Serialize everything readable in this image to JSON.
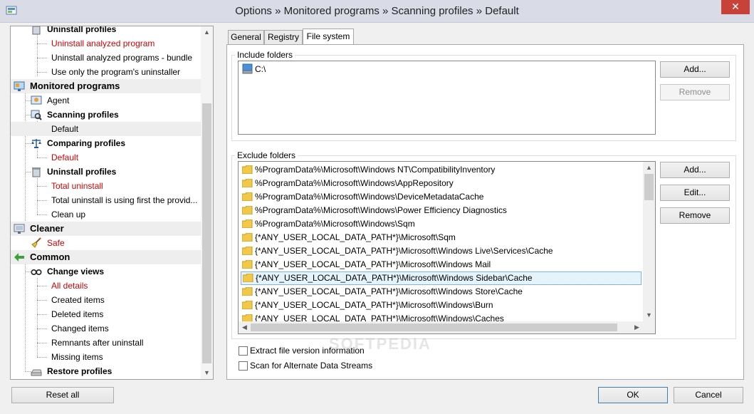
{
  "window": {
    "title": "Options » Monitored programs » Scanning profiles » Default",
    "close_glyph": "✕"
  },
  "tree": {
    "items": [
      {
        "label": "Uninstall profiles"
      },
      {
        "label": "Uninstall analyzed program"
      },
      {
        "label": "Uninstall analyzed programs - bundle"
      },
      {
        "label": "Use only the program's uninstaller"
      },
      {
        "label": "Monitored programs"
      },
      {
        "label": "Agent"
      },
      {
        "label": "Scanning profiles"
      },
      {
        "label": "Default"
      },
      {
        "label": "Comparing profiles"
      },
      {
        "label": "Default"
      },
      {
        "label": "Uninstall profiles"
      },
      {
        "label": "Total uninstall"
      },
      {
        "label": "Total uninstall is using first the provid..."
      },
      {
        "label": "Clean up"
      },
      {
        "label": "Cleaner"
      },
      {
        "label": "Safe"
      },
      {
        "label": "Common"
      },
      {
        "label": "Change views"
      },
      {
        "label": "All details"
      },
      {
        "label": "Created items"
      },
      {
        "label": "Deleted items"
      },
      {
        "label": "Changed items"
      },
      {
        "label": "Remnants after uninstall"
      },
      {
        "label": "Missing items"
      },
      {
        "label": "Restore profiles"
      }
    ]
  },
  "tabs": [
    {
      "label": "General"
    },
    {
      "label": "Registry"
    },
    {
      "label": "File system"
    }
  ],
  "include": {
    "label": "Include folders",
    "items": [
      "C:\\"
    ],
    "add_button": "Add...",
    "remove_button": "Remove"
  },
  "exclude": {
    "label": "Exclude folders",
    "items": [
      "%ProgramData%\\Microsoft\\Windows NT\\CompatibilityInventory",
      "%ProgramData%\\Microsoft\\Windows\\AppRepository",
      "%ProgramData%\\Microsoft\\Windows\\DeviceMetadataCache",
      "%ProgramData%\\Microsoft\\Windows\\Power Efficiency Diagnostics",
      "%ProgramData%\\Microsoft\\Windows\\Sqm",
      "{*ANY_USER_LOCAL_DATA_PATH*}\\Microsoft\\Sqm",
      "{*ANY_USER_LOCAL_DATA_PATH*}\\Microsoft\\Windows Live\\Services\\Cache",
      "{*ANY_USER_LOCAL_DATA_PATH*}\\Microsoft\\Windows Mail",
      "{*ANY_USER_LOCAL_DATA_PATH*}\\Microsoft\\Windows Sidebar\\Cache",
      "{*ANY_USER_LOCAL_DATA_PATH*}\\Microsoft\\Windows Store\\Cache",
      "{*ANY_USER_LOCAL_DATA_PATH*}\\Microsoft\\Windows\\Burn",
      "{*ANY_USER_LOCAL_DATA_PATH*}\\Microsoft\\Windows\\Caches"
    ],
    "add_button": "Add...",
    "edit_button": "Edit...",
    "remove_button": "Remove"
  },
  "options": {
    "extract_version": "Extract file version information",
    "scan_ads": "Scan for Alternate Data Streams"
  },
  "footer": {
    "reset_all": "Reset all",
    "ok": "OK",
    "cancel": "Cancel"
  },
  "watermark": "SOFTPEDIA",
  "colors": {
    "accent_red": "#d40000",
    "selection": "#e5f3fb",
    "close": "#c7433a"
  }
}
